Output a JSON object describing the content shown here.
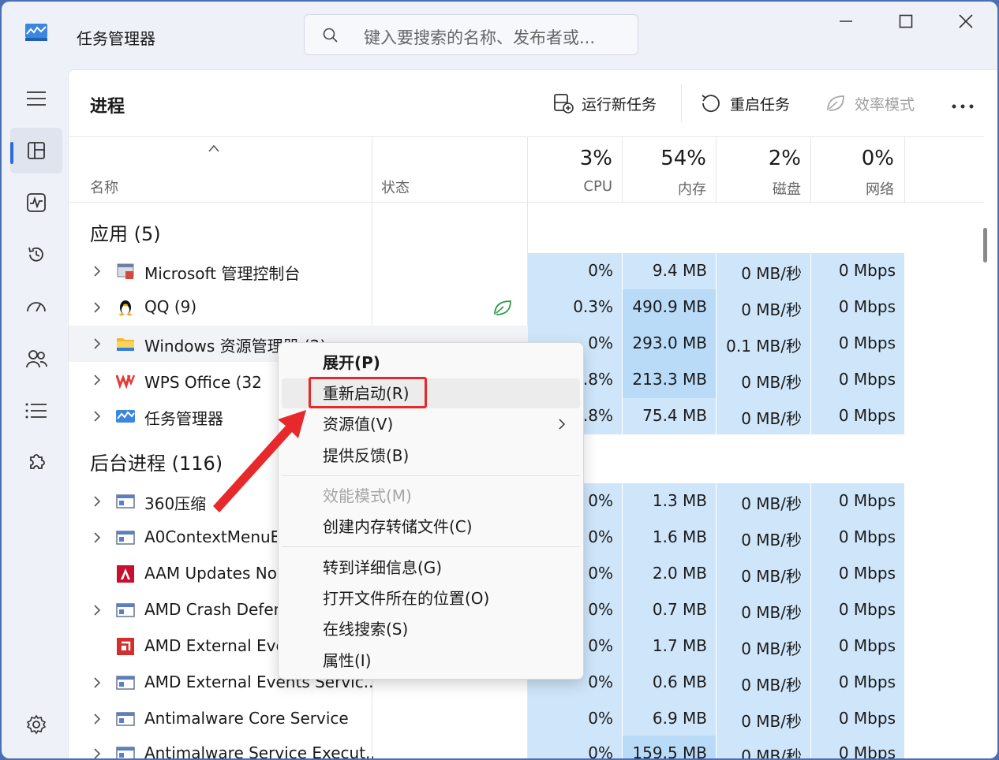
{
  "window": {
    "title": "任务管理器",
    "search_placeholder": "键入要搜索的名称、发布者或..."
  },
  "toolbar": {
    "page_title": "进程",
    "run_new_task": "运行新任务",
    "restart_task": "重启任务",
    "efficiency_mode": "效率模式"
  },
  "columns": {
    "name": "名称",
    "status": "状态",
    "cpu_pct": "3%",
    "cpu_label": "CPU",
    "mem_pct": "54%",
    "mem_label": "内存",
    "disk_pct": "2%",
    "disk_label": "磁盘",
    "net_pct": "0%",
    "net_label": "网络"
  },
  "groups": {
    "apps": "应用 (5)",
    "background": "后台进程 (116)"
  },
  "rows": [
    {
      "name": "Microsoft 管理控制台",
      "cpu": "0%",
      "mem": "9.4 MB",
      "disk": "0 MB/秒",
      "net": "0 Mbps"
    },
    {
      "name": "QQ (9)",
      "cpu": "0.3%",
      "mem": "490.9 MB",
      "disk": "0 MB/秒",
      "net": "0 Mbps"
    },
    {
      "name": "Windows 资源管理器 (2)",
      "cpu": "0%",
      "mem": "293.0 MB",
      "disk": "0.1 MB/秒",
      "net": "0 Mbps"
    },
    {
      "name": "WPS Office (32 位",
      "cpu": ".8%",
      "mem": "213.3 MB",
      "disk": "0 MB/秒",
      "net": "0 Mbps"
    },
    {
      "name": "任务管理器",
      "cpu": ".8%",
      "mem": "75.4 MB",
      "disk": "0 MB/秒",
      "net": "0 Mbps"
    },
    {
      "name": "360压缩",
      "cpu": "0%",
      "mem": "1.3 MB",
      "disk": "0 MB/秒",
      "net": "0 Mbps"
    },
    {
      "name": "A0ContextMenuE",
      "cpu": "0%",
      "mem": "1.6 MB",
      "disk": "0 MB/秒",
      "net": "0 Mbps"
    },
    {
      "name": "AAM Updates No",
      "cpu": "0%",
      "mem": "2.0 MB",
      "disk": "0 MB/秒",
      "net": "0 Mbps"
    },
    {
      "name": "AMD Crash Defen",
      "cpu": "0%",
      "mem": "0.7 MB",
      "disk": "0 MB/秒",
      "net": "0 Mbps"
    },
    {
      "name": "AMD External Eve",
      "cpu": "0%",
      "mem": "1.7 MB",
      "disk": "0 MB/秒",
      "net": "0 Mbps"
    },
    {
      "name": "AMD External Events Servic...",
      "cpu": "0%",
      "mem": "0.6 MB",
      "disk": "0 MB/秒",
      "net": "0 Mbps"
    },
    {
      "name": "Antimalware Core Service",
      "cpu": "0%",
      "mem": "6.9 MB",
      "disk": "0 MB/秒",
      "net": "0 Mbps"
    },
    {
      "name": "Antimalware Service Execut...",
      "cpu": "0%",
      "mem": "159.5 MB",
      "disk": "0 MB/秒",
      "net": "0 Mbps"
    }
  ],
  "context_menu": {
    "expand": "展开(P)",
    "restart": "重新启动(R)",
    "resource_values": "资源值(V)",
    "feedback": "提供反馈(B)",
    "efficiency": "效能模式(M)",
    "dump": "创建内存转储文件(C)",
    "details": "转到详细信息(G)",
    "open_location": "打开文件所在的位置(O)",
    "search_online": "在线搜索(S)",
    "properties": "属性(I)"
  },
  "colors": {
    "highlight_light": "#cfe6fa",
    "highlight_dark": "#b9dbf7",
    "accent": "#2b6cd8",
    "annotation_red": "#e8292b"
  }
}
